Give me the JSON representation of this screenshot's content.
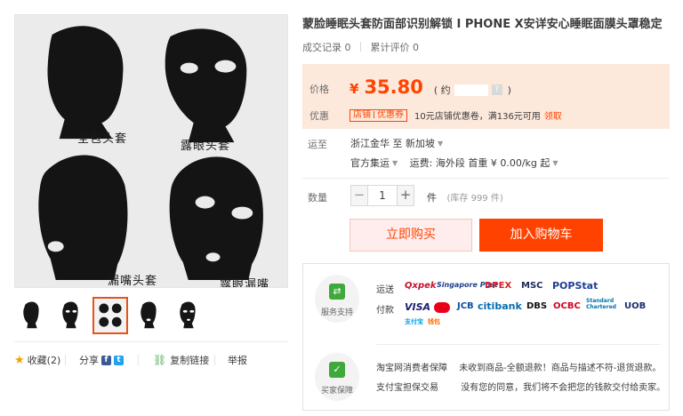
{
  "product": {
    "title": "蒙脸睡眠头套防面部识别解锁 I PHONE X安详安心睡眠面膜头罩稳定",
    "stats": {
      "transactions_label": "成交记录",
      "transactions": "0",
      "reviews_label": "累计评价",
      "reviews": "0"
    }
  },
  "gallery": {
    "captions": [
      "全包头套",
      "露眼头套",
      "漏嘴头套",
      "露眼漏嘴"
    ],
    "thumb_count": 5,
    "active_thumb": 3
  },
  "share": {
    "favorite_label": "收藏(2)",
    "share_label": "分享",
    "facebook_glyph": "f",
    "twitter_glyph": "t",
    "copy_link_label": "复制链接",
    "report_label": "举报"
  },
  "price": {
    "label": "价格",
    "currency": "¥",
    "value": "35.80",
    "approx_open": "( 约",
    "approx_close": ")",
    "help_glyph": "?"
  },
  "promo": {
    "label": "优惠",
    "tag_left": "店铺",
    "tag_right": "优惠券",
    "text": "10元店铺优惠卷，满136元可用",
    "receive_label": "领取"
  },
  "shipping": {
    "label": "运至",
    "from": "浙江金华 至",
    "to": "新加坡",
    "method": "官方集运",
    "fee_label": "运费:",
    "fee_value": "海外段 首重 ¥ 0.00/kg 起"
  },
  "quantity": {
    "label": "数量",
    "minus": "−",
    "value": "1",
    "plus": "+",
    "unit": "件",
    "stock": "(库存 999 件)"
  },
  "actions": {
    "buy_now": "立即购买",
    "add_to_cart": "加入购物车"
  },
  "service": {
    "service_badge": "服务支持",
    "shipping_label": "运送",
    "shipping_logos": [
      "Qxpek",
      "Singapore Post",
      "DPEX",
      "MSC",
      "POPStat"
    ],
    "payment_label": "付款",
    "payment_logos": [
      "VISA",
      "MC",
      "JCB",
      "citibank",
      "DBS",
      "OCBC",
      "Standard Chartered",
      "UOB",
      "支付宝",
      "钱包"
    ],
    "buyer_badge": "买家保障",
    "guarantee": [
      {
        "name": "淘宝网消费者保障",
        "text": "未收到商品-全额退款！商品与描述不符-退货退款。"
      },
      {
        "name": "支付宝担保交易",
        "text": "没有您的同意，我们将不会把您的钱款交付给卖家。"
      }
    ]
  },
  "colors": {
    "accent": "#ff4400",
    "price_bg": "#fde9dc",
    "cart_button": "#ff4200",
    "service_green": "#40a93b"
  }
}
